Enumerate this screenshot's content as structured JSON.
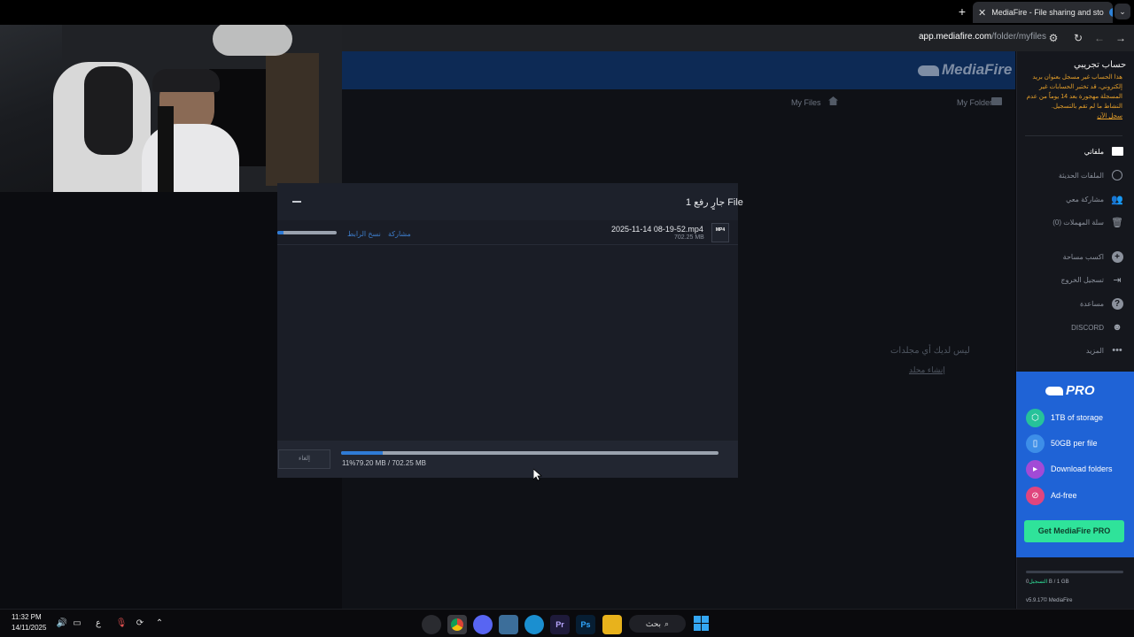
{
  "browser": {
    "tab_title": "MediaFire - File sharing and sto",
    "close_tab": "✕",
    "new_tab": "+",
    "tab_menu": "⌄",
    "url_host": "app.mediafire.com",
    "url_path": "/folder/myfiles"
  },
  "site": {
    "logo_text": "MediaFire",
    "breadcrumb_myfiles": "My Files",
    "breadcrumb_myfolders": "My Folders",
    "empty_message": "ليس لديك أي مجلدات",
    "create_folder": "إنشاء مجلد"
  },
  "upload_dialog": {
    "title": "جارٍ رفع 1 File",
    "file": {
      "type_badge": "MP4",
      "name": "2025-11-14 08-19-52.mp4",
      "size": "702.25 MB",
      "share_link": "مشاركة",
      "copy_link": "نسخ الرابط",
      "progress": 0.11
    },
    "cancel_label": "إلغاء",
    "total_progress": 0.11,
    "total_text": "11%79.20 MB / 702.25 MB"
  },
  "sidebar": {
    "account_title": "حساب تجريبي",
    "warning_text": "هذا الحساب غير مسجل بعنوان بريد إلكتروني، قد تختبر الحسابات غير المسجلة مهجورة بعد 14 يوماً من عدم النشاط ما لم تقم بالتسجيل.",
    "register_now": "سجل الآن",
    "nav": [
      {
        "label": "ملفاتي",
        "icon": "folder-icon",
        "active": true
      },
      {
        "label": "الملفات الحديثة",
        "icon": "clock-icon",
        "active": false
      },
      {
        "label": "مشاركة معي",
        "icon": "people-icon",
        "active": false
      },
      {
        "label": "سلة المهملات (0)",
        "icon": "trash-icon",
        "active": false
      },
      {
        "label": "اكسب مساحة",
        "icon": "plus-circle-icon",
        "active": false
      },
      {
        "label": "تسجيل الخروج",
        "icon": "logout-icon",
        "active": false
      },
      {
        "label": "مساعدة",
        "icon": "help-icon",
        "active": false
      },
      {
        "label": "DISCORD",
        "icon": "discord-icon",
        "active": false
      },
      {
        "label": "المزيد",
        "icon": "more-icon",
        "active": false
      }
    ],
    "pro": {
      "logo_text": "PRO",
      "features": [
        {
          "label": "1TB of storage",
          "icon": "cube-icon",
          "color": "#26c29a"
        },
        {
          "label": "50GB per file",
          "icon": "file-icon",
          "color": "#3d8ee8"
        },
        {
          "label": "Download folders",
          "icon": "folder-download-icon",
          "color": "#a24ad6"
        },
        {
          "label": "Ad-free",
          "icon": "ad-free-icon",
          "color": "#e0457e"
        }
      ],
      "cta": "Get MediaFire PRO"
    },
    "storage_used": "0 B / 1 GB",
    "storage_register": "التسجيل",
    "storage_fraction": 0.0,
    "version": "v5.9.17© MediaFire"
  },
  "taskbar": {
    "time": "11:32 PM",
    "date": "14/11/2025",
    "lang": "ع",
    "search_label": "بحث",
    "apps": [
      {
        "name": "unknown-app-icon",
        "label": ""
      },
      {
        "name": "chrome-icon",
        "label": ""
      },
      {
        "name": "discord-app-icon",
        "label": ""
      },
      {
        "name": "task-view-icon",
        "label": ""
      },
      {
        "name": "edge-icon",
        "label": ""
      },
      {
        "name": "premiere-icon",
        "label": "Pr"
      },
      {
        "name": "photoshop-icon",
        "label": "Ps"
      },
      {
        "name": "file-explorer-icon",
        "label": ""
      }
    ]
  },
  "colors": {
    "header_blue": "#0d2a55",
    "pro_blue": "#1f63d6",
    "accent_green": "#2fe39a",
    "warning_orange": "#e8a12a",
    "progress_blue": "#2f7bd6"
  }
}
